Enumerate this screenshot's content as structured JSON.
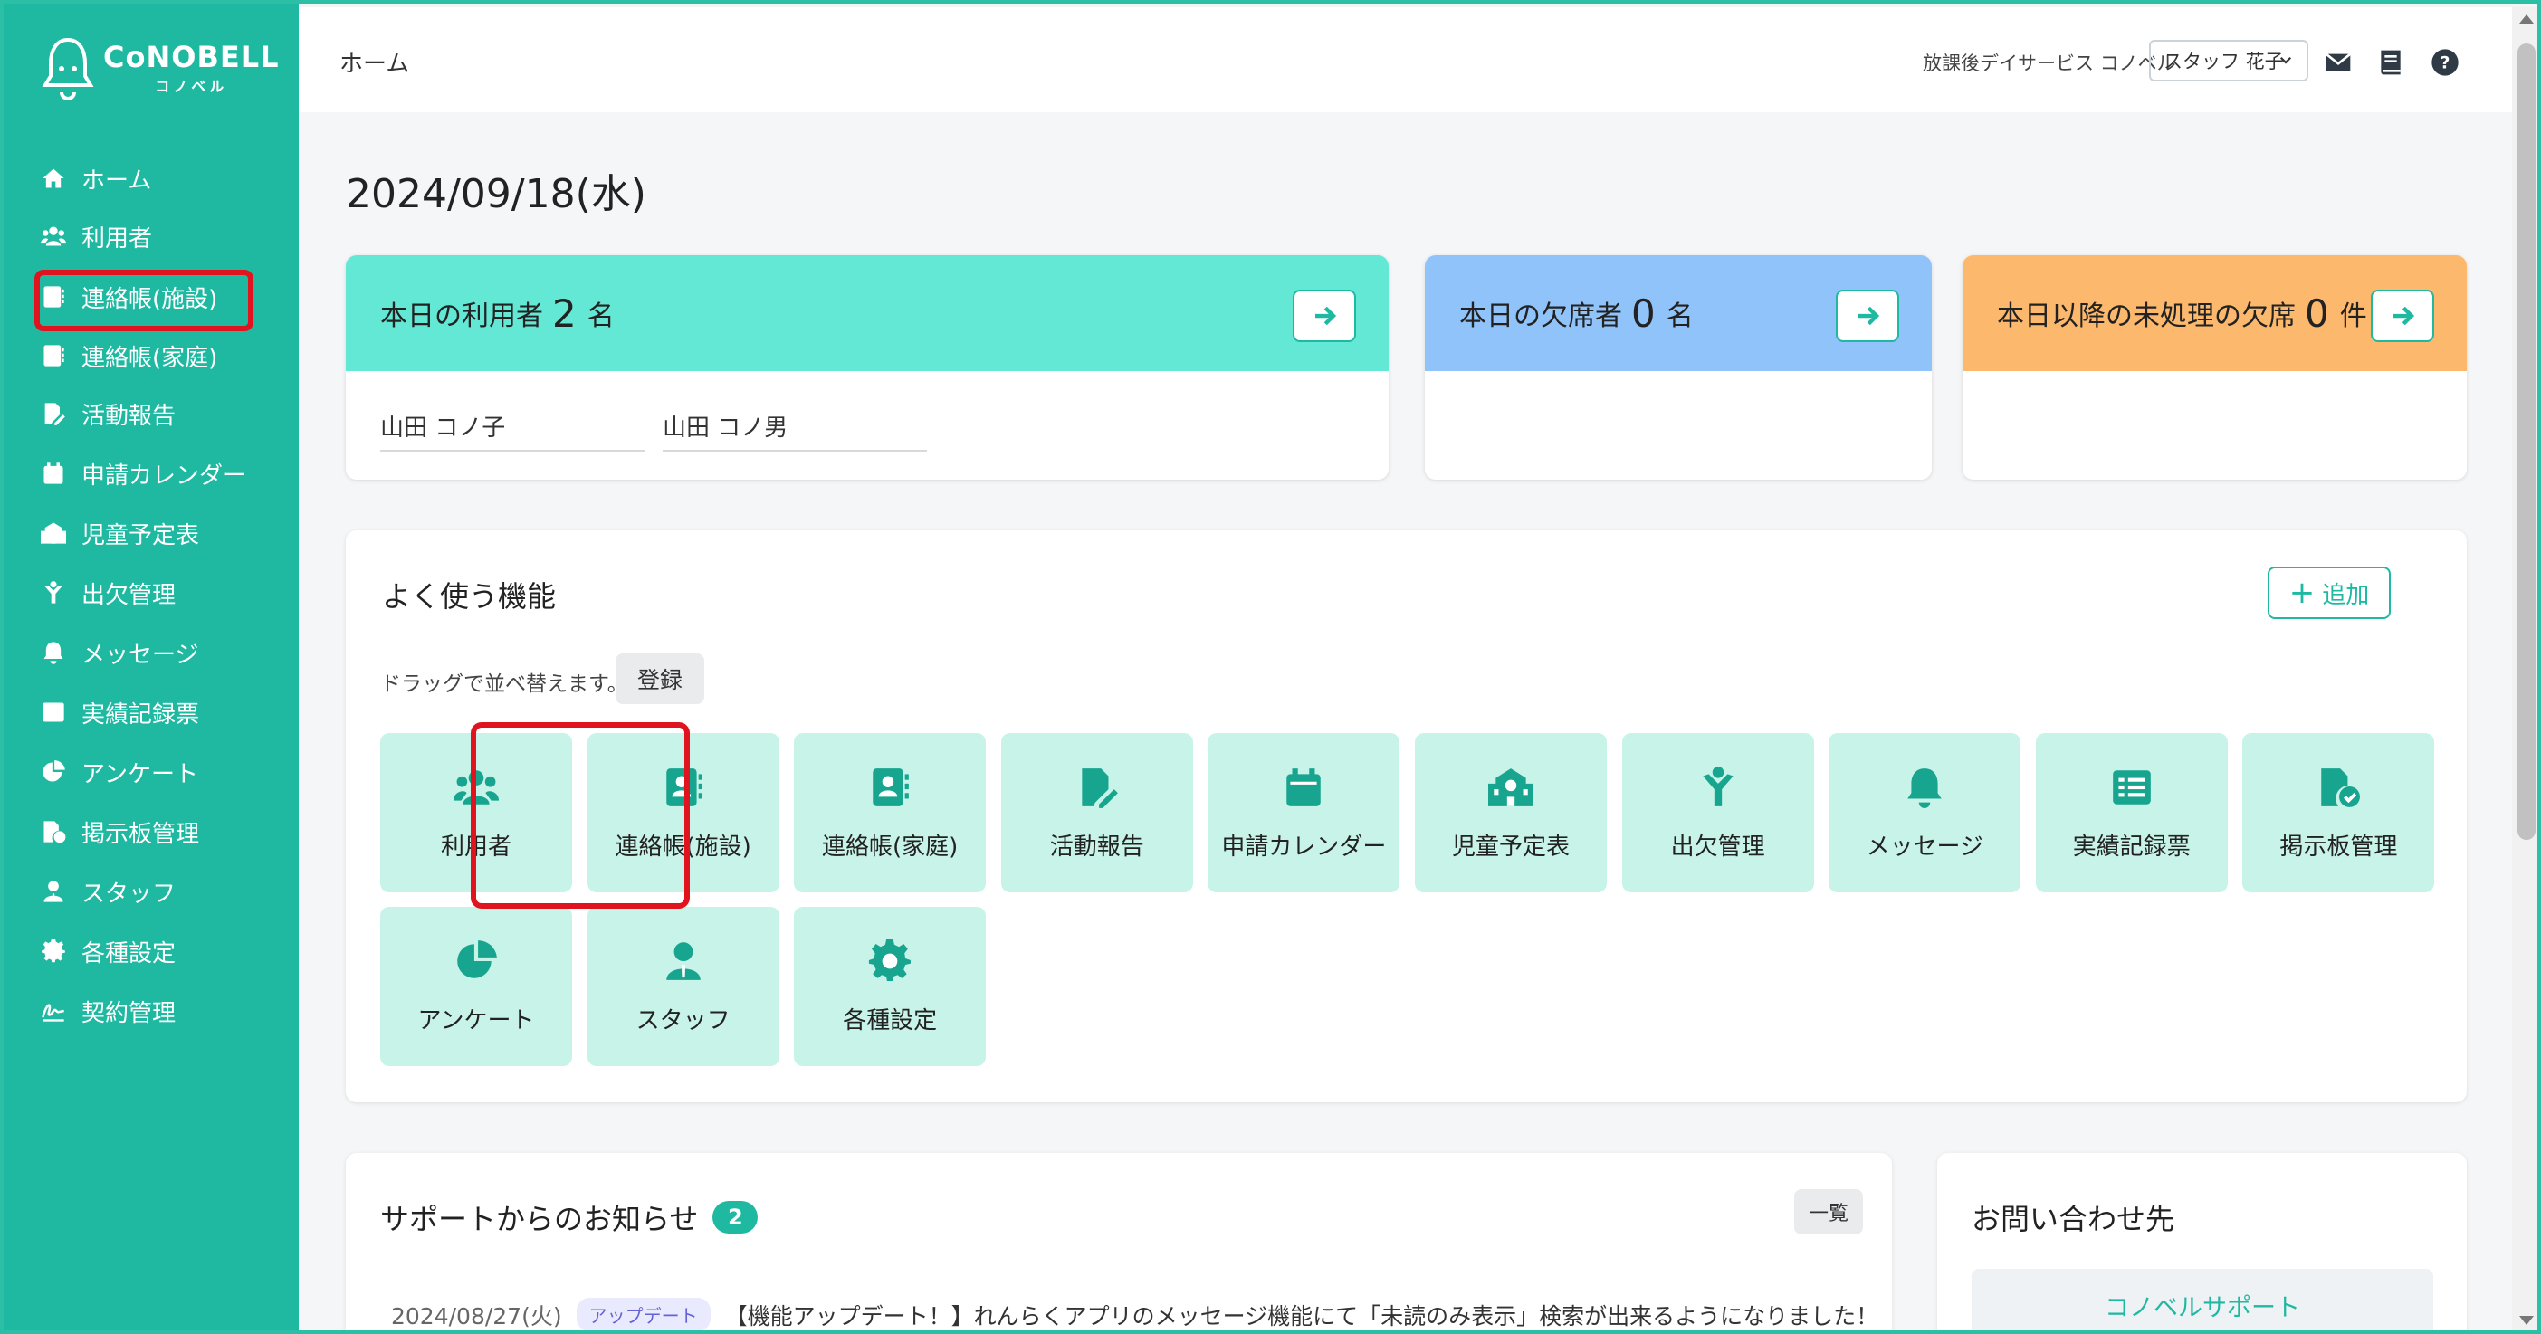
{
  "app": {
    "logo_main": "CoNOBELL",
    "logo_sub": "コノベル"
  },
  "sidebar": {
    "items": [
      {
        "label": "ホーム",
        "icon": "home-icon"
      },
      {
        "label": "利用者",
        "icon": "users-icon"
      },
      {
        "label": "連絡帳(施設)",
        "icon": "contact-book-icon"
      },
      {
        "label": "連絡帳(家庭)",
        "icon": "contact-book-icon"
      },
      {
        "label": "活動報告",
        "icon": "report-edit-icon"
      },
      {
        "label": "申請カレンダー",
        "icon": "calendar-icon"
      },
      {
        "label": "児童予定表",
        "icon": "school-icon"
      },
      {
        "label": "出欠管理",
        "icon": "child-icon"
      },
      {
        "label": "メッセージ",
        "icon": "bell-icon"
      },
      {
        "label": "実績記録票",
        "icon": "list-icon"
      },
      {
        "label": "アンケート",
        "icon": "pie-chart-icon"
      },
      {
        "label": "掲示板管理",
        "icon": "board-check-icon"
      },
      {
        "label": "スタッフ",
        "icon": "staff-icon"
      },
      {
        "label": "各種設定",
        "icon": "gear-icon"
      },
      {
        "label": "契約管理",
        "icon": "signature-icon"
      }
    ]
  },
  "header": {
    "breadcrumb": "ホーム",
    "facility": "放課後デイサービス コノベル",
    "staff_selected": "スタッフ 花子"
  },
  "main": {
    "date": "2024/09/18(水)",
    "summary": [
      {
        "label": "本日の利用者",
        "count": "2",
        "unit": "名",
        "color": "#62e8d4",
        "users": [
          "山田 コノ子",
          "山田 コノ男"
        ]
      },
      {
        "label": "本日の欠席者",
        "count": "0",
        "unit": "名",
        "color": "#8fc3fa",
        "users": []
      },
      {
        "label": "本日以降の未処理の欠席",
        "count": "0",
        "unit": "件",
        "color": "#fcb86c",
        "users": []
      }
    ],
    "quick": {
      "title": "よく使う機能",
      "add_label": "追加",
      "drag_hint": "ドラッグで並べ替えます。",
      "register_label": "登録",
      "tiles": [
        {
          "label": "利用者",
          "icon": "users-icon"
        },
        {
          "label": "連絡帳(施設)",
          "icon": "contact-book-icon"
        },
        {
          "label": "連絡帳(家庭)",
          "icon": "contact-book-icon"
        },
        {
          "label": "活動報告",
          "icon": "report-edit-icon"
        },
        {
          "label": "申請カレンダー",
          "icon": "calendar-icon"
        },
        {
          "label": "児童予定表",
          "icon": "school-icon"
        },
        {
          "label": "出欠管理",
          "icon": "child-icon"
        },
        {
          "label": "メッセージ",
          "icon": "bell-icon"
        },
        {
          "label": "実績記録票",
          "icon": "list-icon"
        },
        {
          "label": "掲示板管理",
          "icon": "board-check-icon"
        },
        {
          "label": "アンケート",
          "icon": "pie-chart-icon"
        },
        {
          "label": "スタッフ",
          "icon": "staff-icon"
        },
        {
          "label": "各種設定",
          "icon": "gear-icon"
        }
      ]
    },
    "news": {
      "title": "サポートからのお知らせ",
      "badge": "2",
      "all_label": "一覧",
      "items": [
        {
          "date": "2024/08/27(火)",
          "tag": "アップデート",
          "text": "【機能アップデート！】れんらくアプリのメッセージ機能にて「未読のみ表示」検索が出来るようになりました！"
        }
      ]
    },
    "contact": {
      "title": "お問い合わせ先",
      "link_label": "コノベルサポート"
    }
  },
  "colors": {
    "accent": "#1fb9a2",
    "tile_bg": "#c8f3e8",
    "highlight": "#e0141e"
  }
}
